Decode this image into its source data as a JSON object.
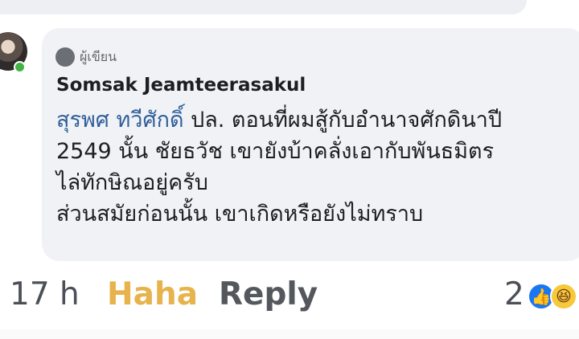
{
  "comment": {
    "badge_label": "ผู้เขียน",
    "author_name": "Somsak Jeamteerasakul",
    "mention": "สุรพศ ทวีศักดิ์",
    "lines": [
      " ปล. ตอนที่ผมสู้กับอำนาจศักดินาปี",
      "2549 นั้น ชัยธวัช เขายังบ้าคลั่งเอากับพันธมิตร",
      "ไล่ทักษิณอยู่ครับ",
      "ส่วนสมัยก่อนนั้น เขาเกิดหรือยังไม่ทราบ"
    ]
  },
  "footer": {
    "time": "17 h",
    "reaction_label": "Haha",
    "reply_label": "Reply",
    "reaction_count": "2"
  },
  "icons": {
    "author_badge": "author-badge-icon",
    "like": "like-reaction-icon",
    "haha": "haha-reaction-icon"
  },
  "colors": {
    "mention": "#315f9d",
    "haha_label": "#e6b34c",
    "bubble": "#f0f2f5"
  }
}
